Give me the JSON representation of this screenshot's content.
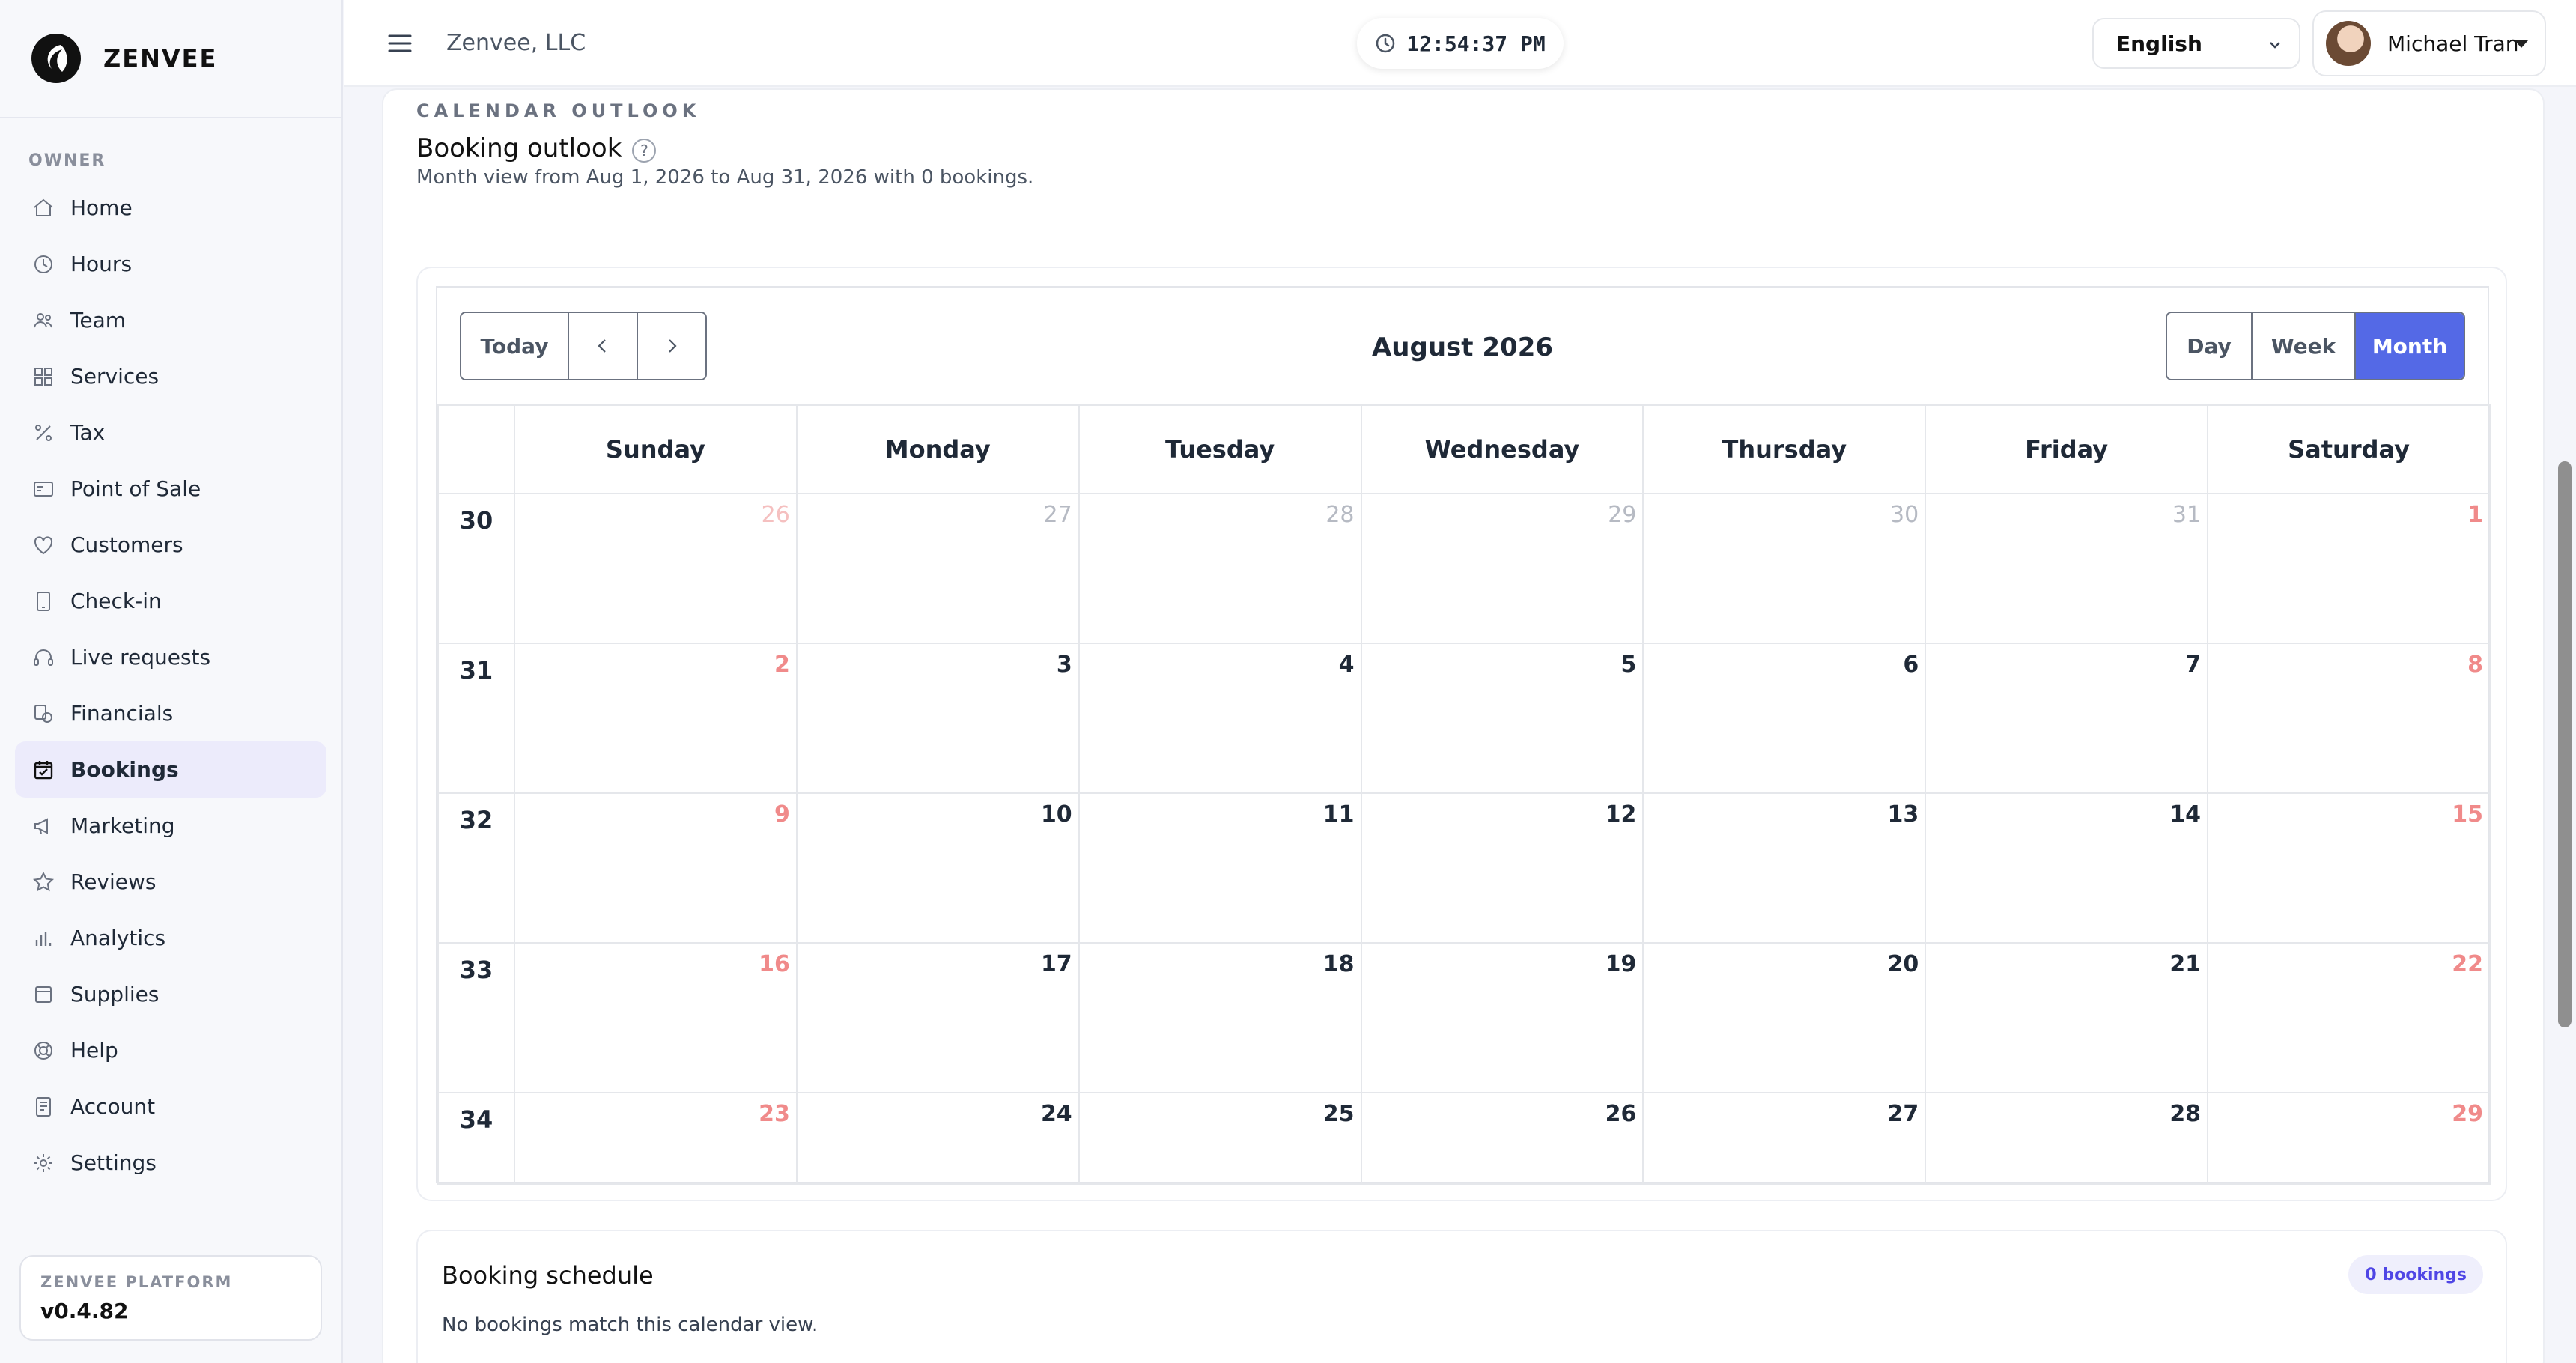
{
  "brand": {
    "name": "ZENVEE"
  },
  "sidebar": {
    "section_label": "OWNER",
    "items": [
      {
        "label": "Home",
        "icon": "home-icon"
      },
      {
        "label": "Hours",
        "icon": "clock-icon"
      },
      {
        "label": "Team",
        "icon": "team-icon"
      },
      {
        "label": "Services",
        "icon": "grid-icon"
      },
      {
        "label": "Tax",
        "icon": "percent-icon"
      },
      {
        "label": "Point of Sale",
        "icon": "pos-icon"
      },
      {
        "label": "Customers",
        "icon": "heart-icon"
      },
      {
        "label": "Check-in",
        "icon": "tablet-icon"
      },
      {
        "label": "Live requests",
        "icon": "headset-icon"
      },
      {
        "label": "Financials",
        "icon": "financials-icon"
      },
      {
        "label": "Bookings",
        "icon": "calendar-check-icon",
        "active": true
      },
      {
        "label": "Marketing",
        "icon": "megaphone-icon"
      },
      {
        "label": "Reviews",
        "icon": "star-icon"
      },
      {
        "label": "Analytics",
        "icon": "bar-chart-icon"
      },
      {
        "label": "Supplies",
        "icon": "box-icon"
      },
      {
        "label": "Help",
        "icon": "lifebuoy-icon"
      },
      {
        "label": "Account",
        "icon": "receipt-icon"
      },
      {
        "label": "Settings",
        "icon": "gear-icon"
      }
    ],
    "platform": {
      "label": "ZENVEE PLATFORM",
      "version": "v0.4.82"
    }
  },
  "header": {
    "company": "Zenvee, LLC",
    "time": "12:54:37 PM",
    "language": "English",
    "user_name": "Michael Tran"
  },
  "main": {
    "eyebrow": "CALENDAR OUTLOOK",
    "title": "Booking outlook",
    "help": "?",
    "subtitle": "Month view from Aug 1, 2026 to Aug 31, 2026 with 0 bookings."
  },
  "calendar": {
    "today_label": "Today",
    "month_title": "August 2026",
    "views": [
      "Day",
      "Week",
      "Month"
    ],
    "active_view": "Month",
    "weekdays": [
      "Sunday",
      "Monday",
      "Tuesday",
      "Wednesday",
      "Thursday",
      "Friday",
      "Saturday"
    ],
    "weeks": [
      {
        "num": "30",
        "days": [
          {
            "d": "26",
            "other": true,
            "weekend": true
          },
          {
            "d": "27",
            "other": true
          },
          {
            "d": "28",
            "other": true
          },
          {
            "d": "29",
            "other": true
          },
          {
            "d": "30",
            "other": true
          },
          {
            "d": "31",
            "other": true
          },
          {
            "d": "1",
            "weekend": true
          }
        ]
      },
      {
        "num": "31",
        "days": [
          {
            "d": "2",
            "weekend": true
          },
          {
            "d": "3"
          },
          {
            "d": "4"
          },
          {
            "d": "5"
          },
          {
            "d": "6"
          },
          {
            "d": "7"
          },
          {
            "d": "8",
            "weekend": true
          }
        ]
      },
      {
        "num": "32",
        "days": [
          {
            "d": "9",
            "weekend": true
          },
          {
            "d": "10"
          },
          {
            "d": "11"
          },
          {
            "d": "12"
          },
          {
            "d": "13"
          },
          {
            "d": "14"
          },
          {
            "d": "15",
            "weekend": true
          }
        ]
      },
      {
        "num": "33",
        "days": [
          {
            "d": "16",
            "weekend": true
          },
          {
            "d": "17"
          },
          {
            "d": "18"
          },
          {
            "d": "19"
          },
          {
            "d": "20"
          },
          {
            "d": "21"
          },
          {
            "d": "22",
            "weekend": true
          }
        ]
      },
      {
        "num": "34",
        "days": [
          {
            "d": "23",
            "weekend": true
          },
          {
            "d": "24"
          },
          {
            "d": "25"
          },
          {
            "d": "26"
          },
          {
            "d": "27"
          },
          {
            "d": "28"
          },
          {
            "d": "29",
            "weekend": true
          }
        ]
      }
    ]
  },
  "schedule": {
    "title": "Booking schedule",
    "badge": "0 bookings",
    "empty": "No bookings match this calendar view."
  },
  "colors": {
    "accent": "#5469e6",
    "weekend_day": "#f08a8a",
    "active_nav_bg": "#ecebfb"
  }
}
